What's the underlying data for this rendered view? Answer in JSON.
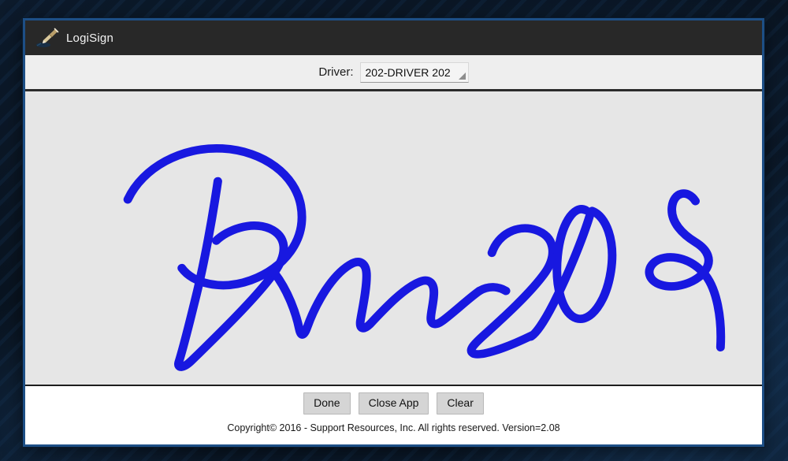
{
  "window": {
    "title": "LogiSign",
    "icon": "pen-stylus-icon",
    "border_color": "#1d4f86",
    "titlebar_color": "#282828"
  },
  "driver_bar": {
    "label": "Driver:",
    "selected": "202-DRIVER 202",
    "caret_icon": "dropdown-caret-icon"
  },
  "signature": {
    "ink_color": "#1818e0",
    "canvas_color": "#e6e6e6",
    "present": true
  },
  "buttons": [
    {
      "name": "done-button",
      "label": "Done"
    },
    {
      "name": "close-app-button",
      "label": "Close App"
    },
    {
      "name": "clear-button",
      "label": "Clear"
    }
  ],
  "footer": {
    "copyright": "Copyright© 2016 - Support Resources, Inc. All rights reserved. Version=2.08"
  }
}
